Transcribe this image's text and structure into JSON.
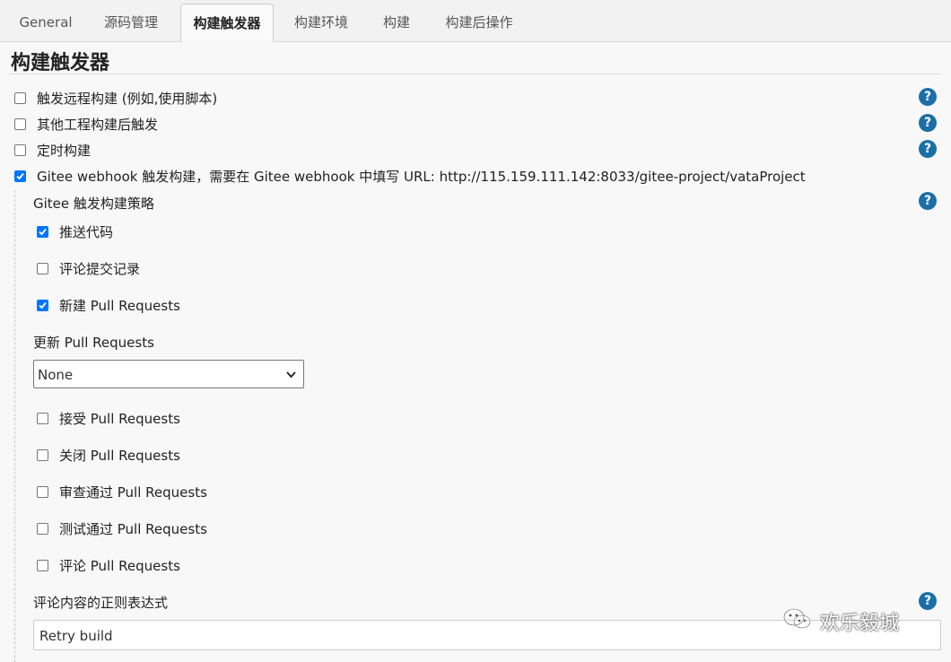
{
  "tabs": [
    {
      "label": "General",
      "active": false
    },
    {
      "label": "源码管理",
      "active": false
    },
    {
      "label": "构建触发器",
      "active": true
    },
    {
      "label": "构建环境",
      "active": false
    },
    {
      "label": "构建",
      "active": false
    },
    {
      "label": "构建后操作",
      "active": false
    }
  ],
  "section": {
    "title": "构建触发器"
  },
  "triggers": [
    {
      "label": "触发远程构建 (例如,使用脚本)",
      "checked": false
    },
    {
      "label": "其他工程构建后触发",
      "checked": false
    },
    {
      "label": "定时构建",
      "checked": false
    },
    {
      "label": "Gitee webhook 触发构建，需要在 Gitee webhook 中填写 URL: http://115.159.111.142:8033/gitee-project/vataProject",
      "checked": true
    }
  ],
  "gitee": {
    "strategy_label": "Gitee 触发构建策略",
    "options_top": [
      {
        "label": "推送代码",
        "checked": true
      },
      {
        "label": "评论提交记录",
        "checked": false
      },
      {
        "label": "新建 Pull Requests",
        "checked": true
      }
    ],
    "update_pr_label": "更新 Pull Requests",
    "update_pr_selected": "None",
    "options_bottom": [
      {
        "label": "接受 Pull Requests",
        "checked": false
      },
      {
        "label": "关闭 Pull Requests",
        "checked": false
      },
      {
        "label": "审查通过 Pull Requests",
        "checked": false
      },
      {
        "label": "测试通过 Pull Requests",
        "checked": false
      },
      {
        "label": "评论 Pull Requests",
        "checked": false
      }
    ],
    "comment_regex_label": "评论内容的正则表达式",
    "comment_regex_value": "Retry build"
  },
  "help_symbol": "?",
  "watermark": {
    "text": "欢乐毅城"
  },
  "colors": {
    "checkbox_checked": "#0075ff",
    "help_icon": "#1b6fa8"
  }
}
